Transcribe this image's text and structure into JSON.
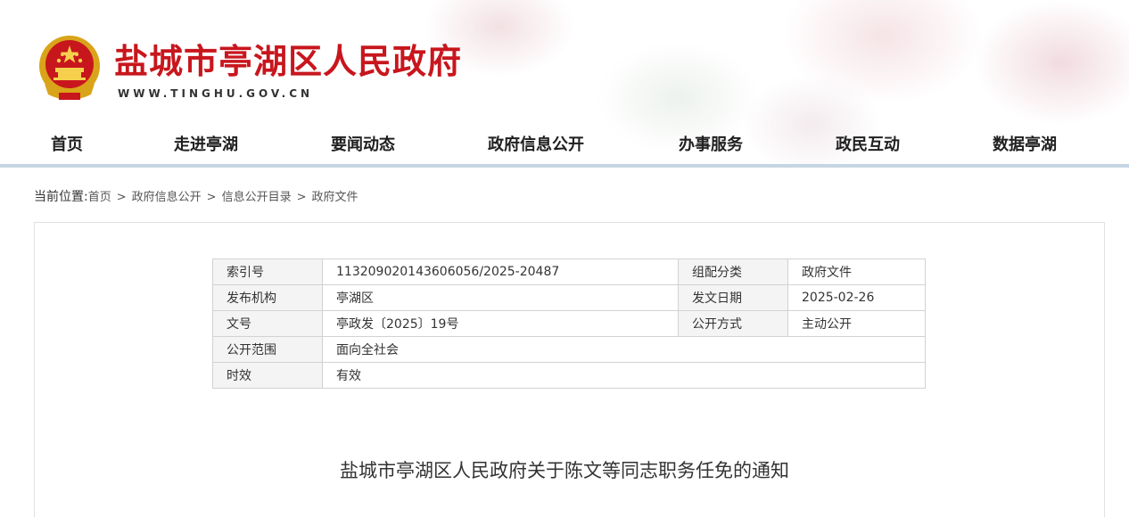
{
  "header": {
    "site_title": "盐城市亭湖区人民政府",
    "site_url": "WWW.TINGHU.GOV.CN",
    "brand_color": "#c8161d",
    "emblem_icon": "national-emblem-icon"
  },
  "nav": {
    "items": [
      "首页",
      "走进亭湖",
      "要闻动态",
      "政府信息公开",
      "办事服务",
      "政民互动",
      "数据亭湖"
    ]
  },
  "breadcrumb": {
    "lead": "当前位置:",
    "items": [
      "首页",
      "政府信息公开",
      "信息公开目录",
      "政府文件"
    ],
    "separator": ">"
  },
  "meta": {
    "index_no_label": "索引号",
    "index_no": "113209020143606056/2025-20487",
    "category_label": "组配分类",
    "category": "政府文件",
    "issuer_label": "发布机构",
    "issuer": "亭湖区",
    "date_label": "发文日期",
    "date": "2025-02-26",
    "doc_no_label": "文号",
    "doc_no": "亭政发〔2025〕19号",
    "disclosure_label": "公开方式",
    "disclosure": "主动公开",
    "scope_label": "公开范围",
    "scope": "面向全社会",
    "validity_label": "时效",
    "validity": "有效"
  },
  "document": {
    "title": "盐城市亭湖区人民政府关于陈文等同志职务任免的通知"
  }
}
